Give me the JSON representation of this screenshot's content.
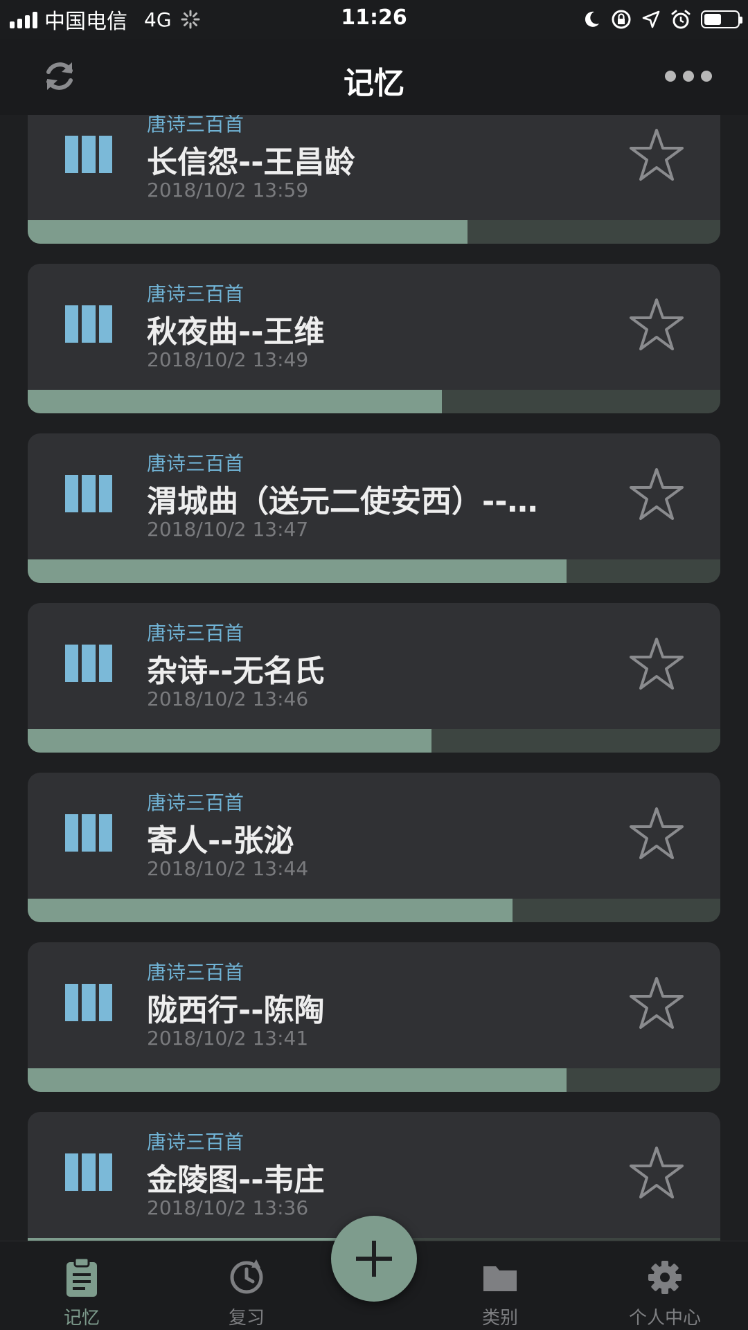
{
  "status_bar": {
    "carrier": "中国电信",
    "network": "4G",
    "time": "11:26"
  },
  "header": {
    "title": "记忆",
    "left_icon": "refresh-icon",
    "right_icon": "more-icon"
  },
  "items": [
    {
      "category": "唐诗三百首",
      "title": "长信怨--王昌龄",
      "date": "2018/10/2 13:59",
      "progress": 0.635
    },
    {
      "category": "唐诗三百首",
      "title": "秋夜曲--王维",
      "date": "2018/10/2 13:49",
      "progress": 0.598
    },
    {
      "category": "唐诗三百首",
      "title": "渭城曲（送元二使安西）--…",
      "date": "2018/10/2 13:47",
      "progress": 0.778
    },
    {
      "category": "唐诗三百首",
      "title": "杂诗--无名氏",
      "date": "2018/10/2 13:46",
      "progress": 0.583
    },
    {
      "category": "唐诗三百首",
      "title": "寄人--张泌",
      "date": "2018/10/2 13:44",
      "progress": 0.7
    },
    {
      "category": "唐诗三百首",
      "title": "陇西行--陈陶",
      "date": "2018/10/2 13:41",
      "progress": 0.778
    },
    {
      "category": "唐诗三百首",
      "title": "金陵图--韦庄",
      "date": "2018/10/2 13:36",
      "progress": 0.5
    }
  ],
  "tabs": [
    {
      "label": "记忆",
      "icon": "clipboard-icon",
      "active": true
    },
    {
      "label": "复习",
      "icon": "history-icon",
      "active": false
    },
    {
      "label": "类别",
      "icon": "folder-icon",
      "active": false
    },
    {
      "label": "个人中心",
      "icon": "gear-icon",
      "active": false
    }
  ],
  "fab_icon": "plus-icon",
  "colors": {
    "accent": "#7e9c8d",
    "category_text": "#71b4d6",
    "card_bg": "#303134",
    "background": "#1e1f21"
  }
}
